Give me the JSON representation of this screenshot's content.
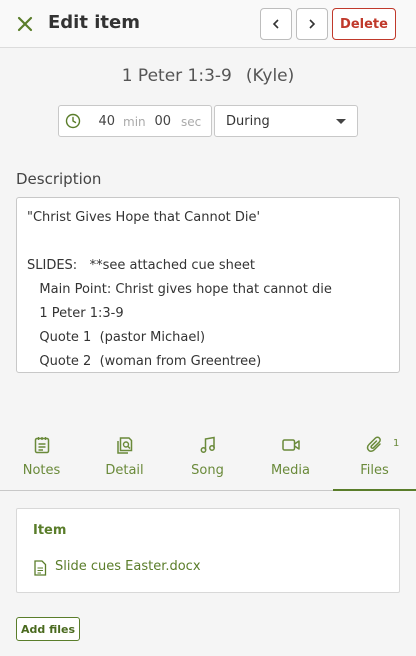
{
  "header": {
    "title": "Edit item",
    "delete_label": "Delete",
    "close_icon": "close-icon",
    "prev_icon": "chevron-left-icon",
    "next_icon": "chevron-right-icon",
    "accent": "#5a7d2a",
    "danger": "#c0392b"
  },
  "item": {
    "reference": "1 Peter 1:3-9",
    "person": "(Kyle)"
  },
  "duration": {
    "minutes": "40",
    "min_unit": "min",
    "seconds": "00",
    "sec_unit": "sec"
  },
  "timing": {
    "selected": "During"
  },
  "description": {
    "label": "Description",
    "lines": [
      "\"Christ Gives Hope that Cannot Die'",
      "",
      "SLIDES:   **see attached cue sheet",
      "   Main Point: Christ gives hope that cannot die",
      "   1 Peter 1:3-9",
      "   Quote 1  (pastor Michael)",
      "   Quote 2  (woman from Greentree)"
    ]
  },
  "tabs": [
    {
      "label": "Notes",
      "icon": "notes-icon"
    },
    {
      "label": "Detail",
      "icon": "detail-icon"
    },
    {
      "label": "Song",
      "icon": "music-note-icon"
    },
    {
      "label": "Media",
      "icon": "video-camera-icon"
    },
    {
      "label": "Files",
      "icon": "paperclip-icon",
      "count": "1",
      "active": true
    }
  ],
  "files": {
    "card_title": "Item",
    "items": [
      {
        "name": "Slide cues Easter.docx",
        "icon": "document-icon"
      }
    ],
    "add_label": "Add files"
  }
}
